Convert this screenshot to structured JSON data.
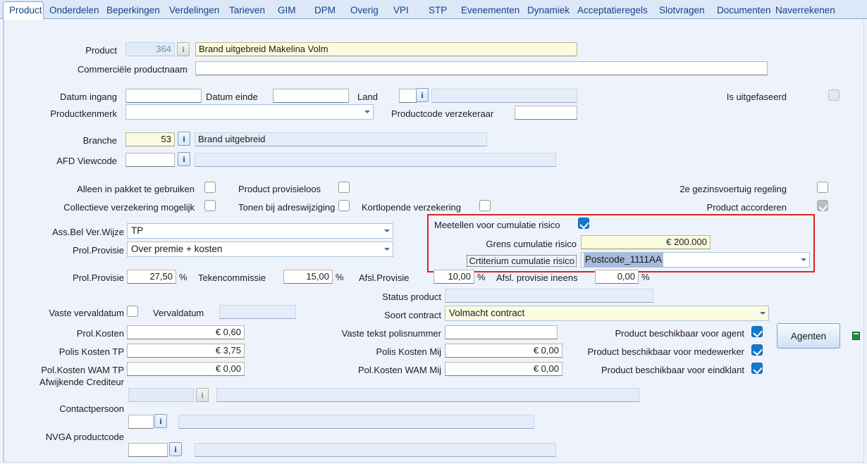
{
  "tabs": [
    {
      "label": "Product",
      "active": true
    },
    {
      "label": "Onderdelen",
      "active": false
    },
    {
      "label": "Beperkingen",
      "active": false
    },
    {
      "label": "Verdelingen",
      "active": false
    },
    {
      "label": "Tarieven",
      "active": false
    },
    {
      "label": "GIM",
      "active": false
    },
    {
      "label": "DPM",
      "active": false
    },
    {
      "label": "Overig",
      "active": false
    },
    {
      "label": "VPI",
      "active": false
    },
    {
      "label": "STP",
      "active": false
    },
    {
      "label": "Evenementen",
      "active": false
    },
    {
      "label": "Dynamiek",
      "active": false
    },
    {
      "label": "Acceptatieregels",
      "active": false
    },
    {
      "label": "Slotvragen",
      "active": false
    },
    {
      "label": "Documenten",
      "active": false
    },
    {
      "label": "Naverrekenen",
      "active": false
    }
  ],
  "form": {
    "product_label": "Product",
    "product_code": "364",
    "product_name": "Brand uitgebreid Makelina Volm",
    "commerciele_productnaam_label": "Commerciële productnaam",
    "commerciele_productnaam": "",
    "datum_ingang_label": "Datum ingang",
    "datum_ingang": "",
    "datum_einde_label": "Datum einde",
    "datum_einde": "",
    "land_label": "Land",
    "land_code": "",
    "land_name": "",
    "is_uitgefaseerd_label": "Is uitgefaseerd",
    "productkenmerk_label": "Productkenmerk",
    "productkenmerk": "",
    "productcode_verzekeraar_label": "Productcode verzekeraar",
    "productcode_verzekeraar": "",
    "branche_label": "Branche",
    "branche_code": "53",
    "branche_name": "Brand uitgebreid",
    "afd_viewcode_label": "AFD Viewcode",
    "afd_viewcode": "",
    "afd_viewcode_name": "",
    "alleen_in_pakket_label": "Alleen in pakket te gebruiken",
    "product_provisieloos_label": "Product provisieloos",
    "collectieve_verzekering_label": "Collectieve verzekering mogelijk",
    "tonen_bij_adreswijziging_label": "Tonen bij adreswijziging",
    "kortlopende_verzekering_label": "Kortlopende verzekering",
    "gezinsvoertuig_label": "2e gezinsvoertuig regeling",
    "product_accorderen_label": "Product accorderen",
    "ass_bel_ver_wijze_label": "Ass.Bel Ver.Wijze",
    "ass_bel_ver_wijze": "TP",
    "prol_provisie_label": "Prol.Provisie",
    "prol_provisie_type": "Over premie + kosten",
    "prol_provisie_pct_label": "Prol.Provisie",
    "prol_provisie_pct": "27,50",
    "tekencommissie_label": "Tekencommissie",
    "tekencommissie": "15,00",
    "afsl_provisie_label": "Afsl.Provisie",
    "afsl_provisie": "10,00",
    "afsl_provisie_ineens_label": "Afsl. provisie ineens",
    "afsl_provisie_ineens": "0,00",
    "pct_symbol": "%",
    "vaste_vervaldatum_label": "Vaste vervaldatum",
    "vervaldatum_label": "Vervaldatum",
    "vervaldatum": "",
    "status_product_label": "Status product",
    "status_product": "",
    "soort_contract_label": "Soort contract",
    "soort_contract": "Volmacht contract",
    "prol_kosten_label": "Prol.Kosten",
    "prol_kosten": "€ 0,60",
    "polis_kosten_tp_label": "Polis Kosten TP",
    "polis_kosten_tp": "€ 3,75",
    "pol_kosten_wam_tp_label": "Pol.Kosten WAM TP",
    "pol_kosten_wam_tp": "€ 0,00",
    "vaste_tekst_polisnummer_label": "Vaste tekst polisnummer",
    "vaste_tekst_polisnummer": "",
    "polis_kosten_mij_label": "Polis Kosten Mij",
    "polis_kosten_mij": "€ 0,00",
    "pol_kosten_wam_mij_label": "Pol.Kosten WAM Mij",
    "pol_kosten_wam_mij": "€ 0,00",
    "beschikbaar_agent_label": "Product beschikbaar voor agent",
    "beschikbaar_medewerker_label": "Product beschikbaar voor medewerker",
    "beschikbaar_eindklant_label": "Product beschikbaar voor eindklant",
    "agenten_button": "Agenten",
    "afwijkende_crediteur_label": "Afwijkende Crediteur",
    "afwijkende_crediteur_code": "",
    "afwijkende_crediteur_name": "",
    "contactpersoon_label": "Contactpersoon",
    "contactpersoon_code": "",
    "contactpersoon_name": "",
    "nvga_productcode_label": "NVGA productcode",
    "nvga_productcode": "",
    "nvga_productcode_name": ""
  },
  "cumulatie": {
    "meetellen_label": "Meetellen voor cumulatie risico",
    "grens_label": "Grens cumulatie risico",
    "grens_value": "€ 200.000",
    "criterium_label": "Crtiterium cumulatie risico",
    "criterium_value": "Postcode_1111AA"
  },
  "icons": {
    "info_icon": "i",
    "excel_icon": "excel-export-icon",
    "dropdown_arrow": "chevron-down-icon"
  },
  "colors": {
    "accent": "#15428b",
    "highlight_red": "#e02020",
    "checkbox_on": "#1878c8",
    "yellow_field": "#fbfbe0",
    "selection_blue": "#a8bcdc"
  }
}
